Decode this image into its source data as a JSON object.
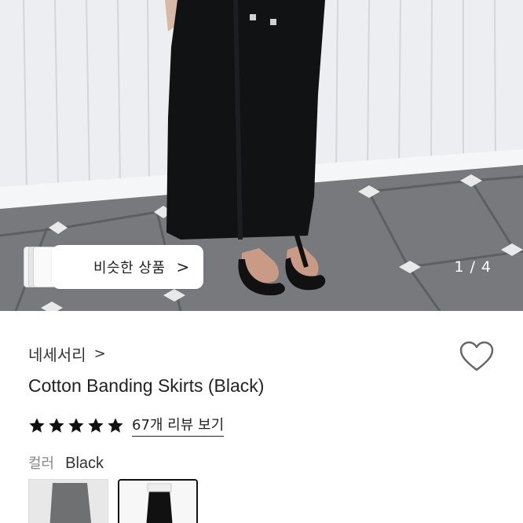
{
  "gallery": {
    "similar_products_label": "비슷한 상품",
    "similar_products_chevron": ">",
    "image_counter": "1 / 4"
  },
  "product": {
    "brand": "네세서리",
    "brand_chevron": ">",
    "title": "Cotton Banding Skirts (Black)",
    "rating_stars": 5,
    "rating_max": 5,
    "review_link": "67개 리뷰 보기",
    "color_label": "컬러",
    "color_value": "Black",
    "swatches": [
      {
        "name": "gray",
        "selected": false
      },
      {
        "name": "black",
        "selected": true
      }
    ]
  },
  "icons": {
    "wishlist": "heart-outline-icon",
    "star": "star-filled-icon"
  },
  "colors": {
    "star": "#111111",
    "counter_text": "#ffffff",
    "secondary_text": "#888888"
  }
}
